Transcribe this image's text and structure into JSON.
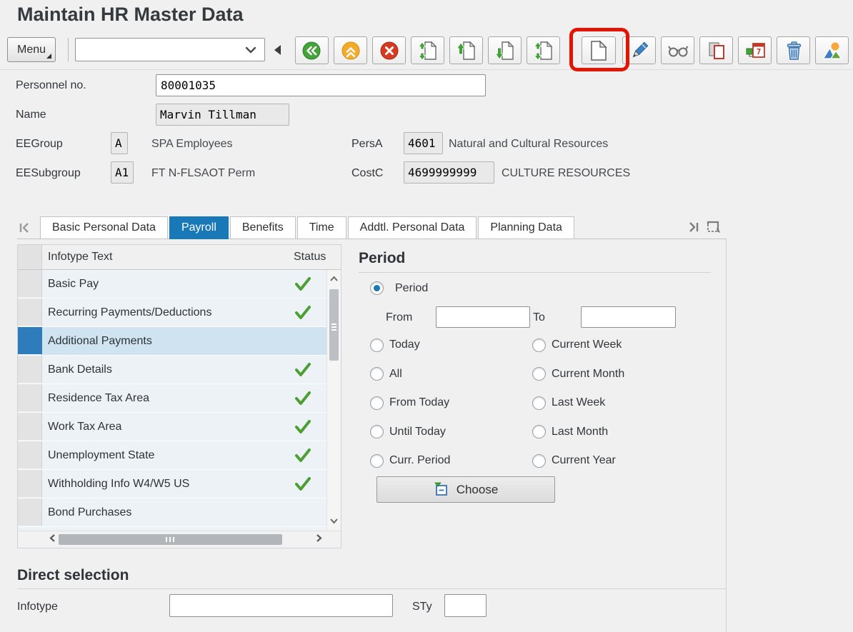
{
  "window": {
    "title": "Maintain HR Master Data"
  },
  "toolbar": {
    "menu_label": "Menu",
    "command_value": "",
    "buttons": [
      {
        "name": "back-button",
        "icon": "back-icon"
      },
      {
        "name": "exit-button",
        "icon": "exit-icon"
      },
      {
        "name": "cancel-button",
        "icon": "cancel-icon"
      },
      {
        "name": "first-record-button",
        "icon": "page-up-down-icon"
      },
      {
        "name": "previous-record-button",
        "icon": "page-up-icon"
      },
      {
        "name": "next-record-button",
        "icon": "page-down-icon"
      },
      {
        "name": "last-record-button",
        "icon": "page-up-down-icon"
      },
      {
        "name": "create-button",
        "icon": "blank-page-icon"
      },
      {
        "name": "change-button",
        "icon": "pencil-icon"
      },
      {
        "name": "display-button",
        "icon": "glasses-icon"
      },
      {
        "name": "copy-button",
        "icon": "copy-icon"
      },
      {
        "name": "delimit-button",
        "icon": "delimit-calendar-icon"
      },
      {
        "name": "delete-button",
        "icon": "trash-icon"
      },
      {
        "name": "overview-button",
        "icon": "mountains-sun-icon"
      }
    ]
  },
  "annotation": {
    "shape": "red-rounded-rectangle",
    "highlights": "create-button",
    "color": "#e51400"
  },
  "employee_header": {
    "personnel_no_label": "Personnel no.",
    "personnel_no_value": "80001035",
    "name_label": "Name",
    "name_value": "Marvin Tillman",
    "eegroup_label": "EEGroup",
    "eegroup_value": "A",
    "eegroup_text": "SPA Employees",
    "eesubgroup_label": "EESubgroup",
    "eesubgroup_value": "A1",
    "eesubgroup_text": "FT N-FLSAOT Perm",
    "persa_label": "PersA",
    "persa_value": "4601",
    "persa_text": "Natural and Cultural Resources",
    "costc_label": "CostC",
    "costc_value": "4699999999",
    "costc_text": "CULTURE RESOURCES"
  },
  "tabs": {
    "items": [
      {
        "label": "Basic Personal Data",
        "active": false
      },
      {
        "label": "Payroll",
        "active": true
      },
      {
        "label": "Benefits",
        "active": false
      },
      {
        "label": "Time",
        "active": false
      },
      {
        "label": "Addtl. Personal Data",
        "active": false
      },
      {
        "label": "Planning Data",
        "active": false
      }
    ]
  },
  "infotype_table": {
    "col_infotype": "Infotype Text",
    "col_status": "Status",
    "rows": [
      {
        "label": "Basic Pay",
        "status": "checked",
        "selected": false
      },
      {
        "label": "Recurring Payments/Deductions",
        "status": "checked",
        "selected": false
      },
      {
        "label": "Additional Payments",
        "status": "",
        "selected": true
      },
      {
        "label": "Bank Details",
        "status": "checked",
        "selected": false
      },
      {
        "label": "Residence Tax Area",
        "status": "checked",
        "selected": false
      },
      {
        "label": "Work Tax Area",
        "status": "checked",
        "selected": false
      },
      {
        "label": "Unemployment State",
        "status": "checked",
        "selected": false
      },
      {
        "label": "Withholding Info W4/W5 US",
        "status": "checked",
        "selected": false
      },
      {
        "label": "Bond Purchases",
        "status": "",
        "selected": false
      }
    ]
  },
  "period": {
    "heading": "Period",
    "period_radio_label": "Period",
    "period_radio_selected": true,
    "from_label": "From",
    "from_value": "",
    "to_label": "To",
    "to_value": "",
    "options_left": [
      "Today",
      "All",
      "From Today",
      "Until Today",
      "Curr. Period"
    ],
    "options_right": [
      "Current Week",
      "Current Month",
      "Last Week",
      "Last Month",
      "Current Year"
    ],
    "choose_label": "Choose"
  },
  "direct_selection": {
    "heading": "Direct selection",
    "infotype_label": "Infotype",
    "infotype_value": "",
    "sty_label": "STy",
    "sty_value": ""
  },
  "colors": {
    "active_tab_blue": "#1878b8",
    "selected_row_bg": "#cfe3f0",
    "selection_bar_blue": "#2e7cbb",
    "check_green": "#4c9f33",
    "annotation_red": "#e51400"
  }
}
